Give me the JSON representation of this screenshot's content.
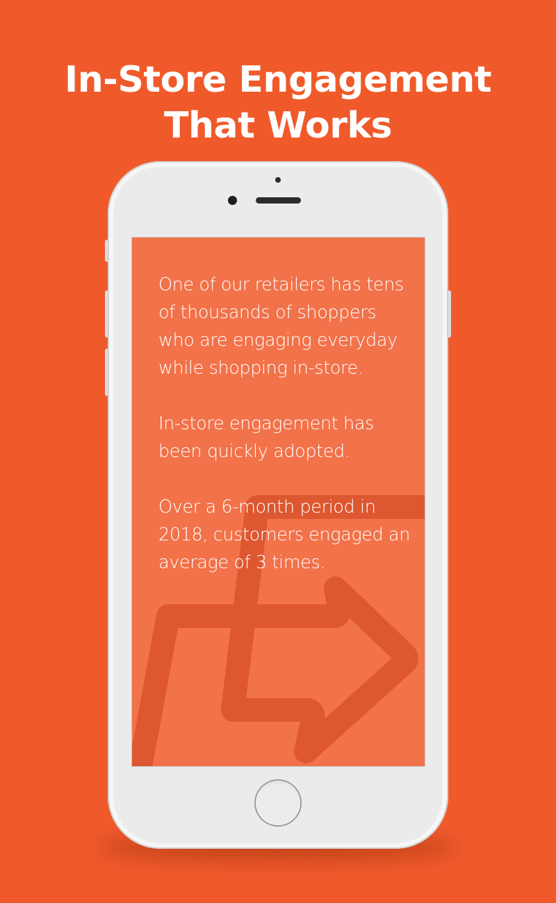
{
  "headline": {
    "line1": "In-Store Engagement",
    "line2": "That Works"
  },
  "phone": {
    "screen_paragraphs": [
      "One of our retailers has tens of thousands of shoppers who are engaging everyday while shopping in-store.",
      "In-store engagement has been quickly adopted.",
      "Over a 6-month period in 2018, customers engaged an average of 3 times."
    ],
    "watermark_icon": "arrow-logo-icon"
  },
  "colors": {
    "background": "#f05a2b",
    "screen": "#f2724a",
    "watermark": "#dd5730",
    "text": "#ffffff",
    "phone": "#ebebeb"
  }
}
